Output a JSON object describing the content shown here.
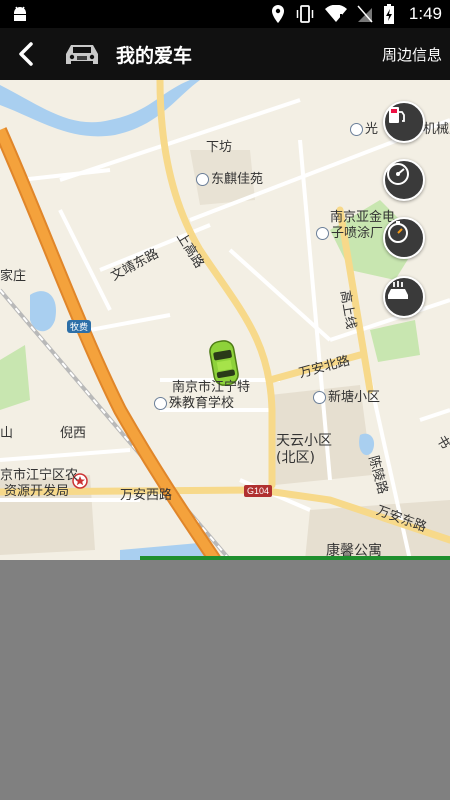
{
  "status_bar": {
    "time": "1:49",
    "icons": [
      "android-icon",
      "location-icon",
      "vibrate-icon",
      "wifi-icon",
      "no-sim-icon",
      "battery-icon"
    ]
  },
  "app_bar": {
    "title": "我的爱车",
    "nearby_label": "周边信息",
    "icons": [
      "back-arrow-icon",
      "car-icon"
    ]
  },
  "map": {
    "labels": {
      "xiafang": "下坊",
      "dongqi_jiayuan": "东麒佳苑",
      "guang": "光",
      "jixie_chang": "机械厂",
      "nanjing_yajin_1": "南京亚金电",
      "nanjing_yajin_2": "子喷涂厂",
      "jiazhuang": "家庄",
      "tekjiao_1": "南京市江宁特",
      "tekjiao_2": "殊教育学校",
      "xintang": "新塘小区",
      "tianyun_1": "天云小区",
      "tianyun_2": "(北区)",
      "nixi": "倪西",
      "shan": "山",
      "nongye_1": "京市江宁区农",
      "nongye_2": "资源开发局",
      "kangxin": "康馨公寓",
      "shanwei": "书"
    },
    "roads": {
      "wenjing": "文靖东路",
      "shanggao": "上高路",
      "gaoshangxian": "高上线",
      "wanan_bei": "万安北路",
      "wanan_xi": "万安西路",
      "wanan_dong": "万安东路",
      "chenling": "陈陵路",
      "g104": "G104",
      "mumu": "牧费"
    },
    "float_buttons": [
      "fuel-pump-icon",
      "speedometer-icon",
      "stopwatch-icon",
      "car-wash-icon"
    ]
  },
  "colors": {
    "map_bg": "#f3efe4",
    "highway": "#f4a23c",
    "main_road": "#f7d98a",
    "water": "#a9cff0",
    "park": "#c8e6b0",
    "bottom_panel": "#808080",
    "car": "#8ed23a"
  }
}
